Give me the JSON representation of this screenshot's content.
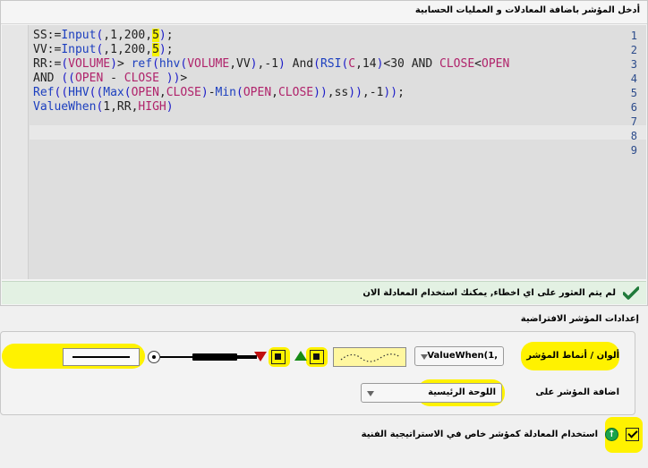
{
  "editor": {
    "title": "أدخل المؤشر باضافة المعادلات و العمليات الحسابية",
    "line_numbers": [
      "1",
      "2",
      "3",
      "4",
      "5",
      "6",
      "7",
      "8",
      "9"
    ],
    "code_lines": [
      "SS:=Input(,1,200,5);",
      "VV:=Input(,1,200,5);",
      "RR:=(VOLUME)> ref(hhv(VOLUME,VV),-1) And(RSI(C,14)<30 AND CLOSE<OPEN",
      "AND ((OPEN - CLOSE ))>",
      "Ref((HHV((Max(OPEN,CLOSE)-Min(OPEN,CLOSE)),ss)),-1));",
      "ValueWhen(1,RR,HIGH)",
      "",
      "",
      ""
    ],
    "status_message": "لم يتم العثور على اي اخطاء, يمكنك استخدام المعادلة الان",
    "status_icon": "check-icon"
  },
  "settings": {
    "title": "إعدادات المؤشر الافتراضية",
    "colors_label": "ألوان / أنماط المؤشر",
    "formula_select_value": "ValueWhen(1,",
    "add_on_label": "اضافة المؤشر على",
    "panel_select_value": "اللوحة الرئيسية",
    "down_color": "#c01010",
    "up_color": "#168a16",
    "highlight_color": "#fff200"
  },
  "footer": {
    "use_as_strategy_label": "استخدام المعادلة كمؤشر خاص في الاستراتيجية الفنية",
    "use_as_strategy_checked": true,
    "info_icon": "info-icon"
  }
}
